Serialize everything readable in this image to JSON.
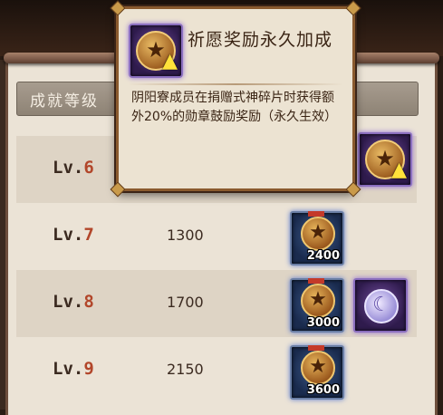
{
  "header": {
    "label": "成就等级"
  },
  "rows": [
    {
      "prefix": "Lv.",
      "level": "6",
      "amount": "",
      "rewards": [
        "wish-boost"
      ]
    },
    {
      "prefix": "Lv.",
      "level": "7",
      "amount": "1300",
      "rewards": [
        {
          "type": "medal",
          "qty": "2400"
        }
      ]
    },
    {
      "prefix": "Lv.",
      "level": "8",
      "amount": "1700",
      "rewards": [
        {
          "type": "medal",
          "qty": "3000"
        },
        {
          "type": "moon-token"
        }
      ]
    },
    {
      "prefix": "Lv.",
      "level": "9",
      "amount": "2150",
      "rewards": [
        {
          "type": "medal",
          "qty": "3600"
        }
      ]
    }
  ],
  "tooltip": {
    "title": "祈愿奖励永久加成",
    "description": "阴阳寮成员在捐赠式神碎片时获得额外20%的勋章鼓励奖励（永久生效）",
    "icon": "medal-boost-icon"
  },
  "colors": {
    "level_number": "#b2462a",
    "panel_bg": "#ebe3d6",
    "tooltip_border": "#8a5a2e"
  }
}
